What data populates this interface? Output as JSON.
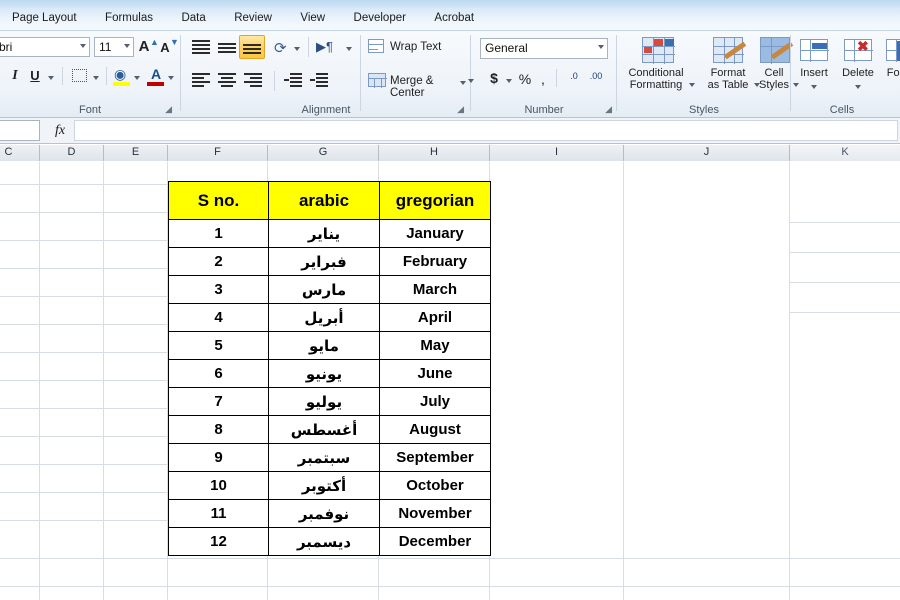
{
  "ribbon": {
    "tabs": [
      {
        "label": "Page Layout"
      },
      {
        "label": "Formulas"
      },
      {
        "label": "Data"
      },
      {
        "label": "Review"
      },
      {
        "label": "View"
      },
      {
        "label": "Developer"
      },
      {
        "label": "Acrobat"
      }
    ],
    "font_group": {
      "label": "Font",
      "font_name": "bri",
      "font_size": "11",
      "grow_font": "A",
      "shrink_font": "A",
      "italic": "I",
      "underline": "U",
      "fill_color": "A",
      "font_color": "A",
      "fill_swatch": "#FFFF00",
      "font_swatch": "#C00000"
    },
    "alignment_group": {
      "label": "Alignment",
      "wrap_text": "Wrap Text",
      "merge_center": "Merge & Center",
      "active_vertical_align": "bottom-align"
    },
    "number_group": {
      "label": "Number",
      "format": "General",
      "currency": "$",
      "percent": "%",
      "comma": ",",
      "increase_decimal": ".0",
      "decrease_decimal": ".00"
    },
    "styles_group": {
      "label": "Styles",
      "buttons": [
        {
          "line1": "Conditional",
          "line2": "Formatting"
        },
        {
          "line1": "Format",
          "line2": "as Table"
        },
        {
          "line1": "Cell",
          "line2": "Styles"
        }
      ]
    },
    "cells_group": {
      "label": "Cells",
      "buttons": [
        {
          "line1": "Insert"
        },
        {
          "line1": "Delete"
        },
        {
          "line1": "For"
        }
      ]
    }
  },
  "formula_bar": {
    "name_box": "",
    "fx_symbol": "fx",
    "formula_value": ""
  },
  "sheet": {
    "column_headers": [
      "C",
      "D",
      "E",
      "F",
      "G",
      "H",
      "I",
      "J",
      "K"
    ],
    "table": {
      "headers": [
        "S no.",
        "arabic",
        "gregorian"
      ],
      "rows": [
        {
          "sno": "1",
          "arabic": "يناير",
          "gregorian": "January"
        },
        {
          "sno": "2",
          "arabic": "فبراير",
          "gregorian": "February"
        },
        {
          "sno": "3",
          "arabic": "مارس",
          "gregorian": "March"
        },
        {
          "sno": "4",
          "arabic": "أبريل",
          "gregorian": "April"
        },
        {
          "sno": "5",
          "arabic": "مايو",
          "gregorian": "May"
        },
        {
          "sno": "6",
          "arabic": "يونيو",
          "gregorian": "June"
        },
        {
          "sno": "7",
          "arabic": "يوليو",
          "gregorian": "July"
        },
        {
          "sno": "8",
          "arabic": "أغسطس",
          "gregorian": "August"
        },
        {
          "sno": "9",
          "arabic": "سبتمبر",
          "gregorian": "September"
        },
        {
          "sno": "10",
          "arabic": "أكتوبر",
          "gregorian": "October"
        },
        {
          "sno": "11",
          "arabic": "نوفمبر",
          "gregorian": "November"
        },
        {
          "sno": "12",
          "arabic": "ديسمبر",
          "gregorian": "December"
        }
      ],
      "header_fill": "#FFFF00"
    }
  }
}
